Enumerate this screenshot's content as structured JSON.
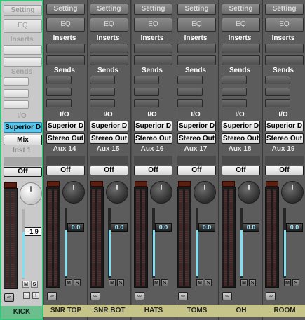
{
  "channels": [
    {
      "name": "KICK",
      "setting": "Setting",
      "eq": "EQ",
      "inserts": "Inserts",
      "sends": "Sends",
      "io_label": "I/O",
      "input": "Superior D",
      "output": "Mix",
      "aux": "Inst 1",
      "automation": "Off",
      "fader_value": "-1.9",
      "mute": "M",
      "solo": "S",
      "selected": true
    },
    {
      "name": "SNR TOP",
      "setting": "Setting",
      "eq": "EQ",
      "inserts": "Inserts",
      "sends": "Sends",
      "io_label": "I/O",
      "input": "Superior D",
      "output": "Stereo Out",
      "aux": "Aux 14",
      "automation": "Off",
      "fader_value": "0.0",
      "mute": "M",
      "solo": "S",
      "selected": false
    },
    {
      "name": "SNR BOT",
      "setting": "Setting",
      "eq": "EQ",
      "inserts": "Inserts",
      "sends": "Sends",
      "io_label": "I/O",
      "input": "Superior D",
      "output": "Stereo Out",
      "aux": "Aux 15",
      "automation": "Off",
      "fader_value": "0.0",
      "mute": "M",
      "solo": "S",
      "selected": false
    },
    {
      "name": "HATS",
      "setting": "Setting",
      "eq": "EQ",
      "inserts": "Inserts",
      "sends": "Sends",
      "io_label": "I/O",
      "input": "Superior D",
      "output": "Stereo Out",
      "aux": "Aux 16",
      "automation": "Off",
      "fader_value": "0.0",
      "mute": "M",
      "solo": "S",
      "selected": false
    },
    {
      "name": "TOMS",
      "setting": "Setting",
      "eq": "EQ",
      "inserts": "Inserts",
      "sends": "Sends",
      "io_label": "I/O",
      "input": "Superior D",
      "output": "Stereo Out",
      "aux": "Aux 17",
      "automation": "Off",
      "fader_value": "0.0",
      "mute": "M",
      "solo": "S",
      "selected": false
    },
    {
      "name": "OH",
      "setting": "Setting",
      "eq": "EQ",
      "inserts": "Inserts",
      "sends": "Sends",
      "io_label": "I/O",
      "input": "Superior D",
      "output": "Stereo Out",
      "aux": "Aux 18",
      "automation": "Off",
      "fader_value": "0.0",
      "mute": "M",
      "solo": "S",
      "selected": false
    },
    {
      "name": "ROOM",
      "setting": "Setting",
      "eq": "EQ",
      "inserts": "Inserts",
      "sends": "Sends",
      "io_label": "I/O",
      "input": "Superior D",
      "output": "Stereo Out",
      "aux": "Aux 19",
      "automation": "Off",
      "fader_value": "0.0",
      "mute": "M",
      "solo": "S",
      "selected": false
    }
  ],
  "selected_controls": {
    "minus": "−",
    "plus": "+"
  },
  "colors": {
    "selected_border": "#37c37a",
    "selected_name_bg": "#6bbf8d",
    "name_bar_bg": "#c7c48a",
    "input_highlight": "#55c8ef",
    "fader_fill": "#7ee0f0"
  },
  "icons": {
    "link": "link-icon"
  }
}
